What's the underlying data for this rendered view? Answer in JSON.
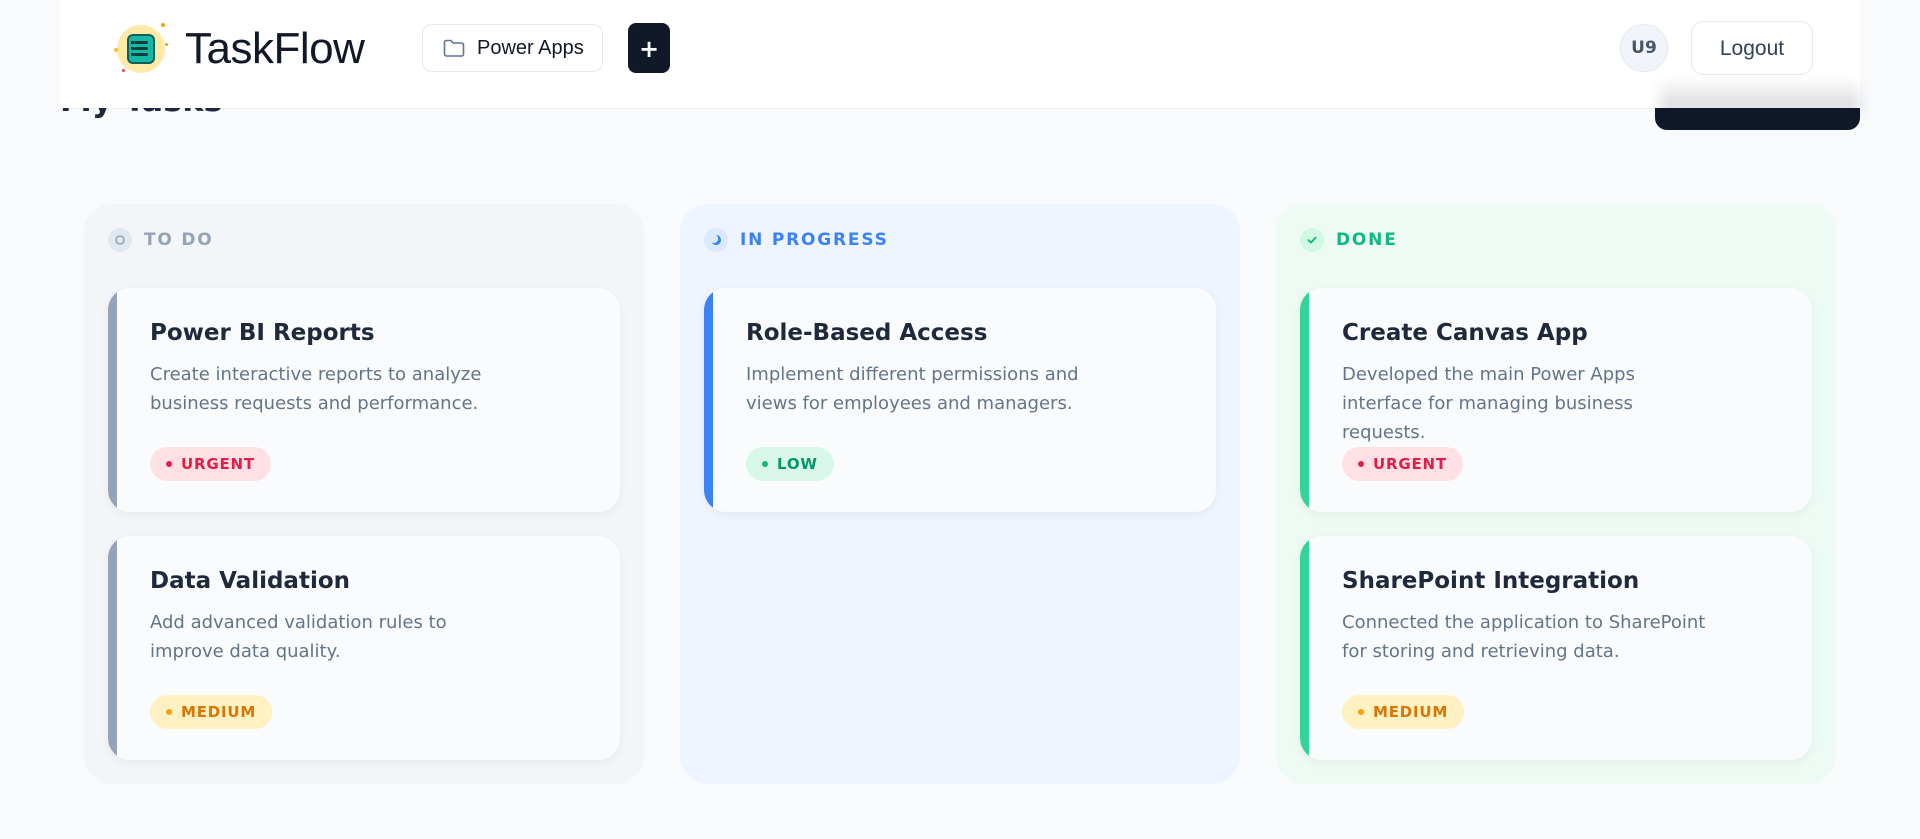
{
  "header": {
    "brand": "TaskFlow",
    "logo_icon": "task-board-icon",
    "project": {
      "label": "Power Apps",
      "icon": "folder-icon"
    },
    "add_label": "+",
    "avatar_initials": "U9",
    "logout_label": "Logout"
  },
  "page": {
    "title": "My Tasks"
  },
  "colors": {
    "todo": "#94a3b8",
    "in_progress": "#3b82f6",
    "done": "#34d399",
    "urgent_bg": "#ffe0e5",
    "urgent_fg": "#e11d48",
    "low_bg": "#d8f7e8",
    "low_fg": "#059669",
    "medium_bg": "#fff1c2",
    "medium_fg": "#d97706"
  },
  "columns": [
    {
      "title": "TO DO",
      "icon": "circle-icon",
      "cards": [
        {
          "title": "Power BI Reports",
          "description": "Create interactive reports to analyze business requests and performance.",
          "priority": "URGENT"
        },
        {
          "title": "Data Validation",
          "description": "Add advanced validation rules to improve data quality.",
          "priority": "MEDIUM"
        }
      ]
    },
    {
      "title": "IN PROGRESS",
      "icon": "half-moon-icon",
      "cards": [
        {
          "title": "Role-Based Access",
          "description": "Implement different permissions and views for employees and managers.",
          "priority": "LOW"
        }
      ]
    },
    {
      "title": "DONE",
      "icon": "check-icon",
      "cards": [
        {
          "title": "Create Canvas App",
          "description": "Developed the main Power Apps interface for managing business requests.",
          "priority": "URGENT"
        },
        {
          "title": "SharePoint Integration",
          "description": "Connected the application to SharePoint for storing and retrieving data.",
          "priority": "MEDIUM"
        }
      ]
    }
  ]
}
